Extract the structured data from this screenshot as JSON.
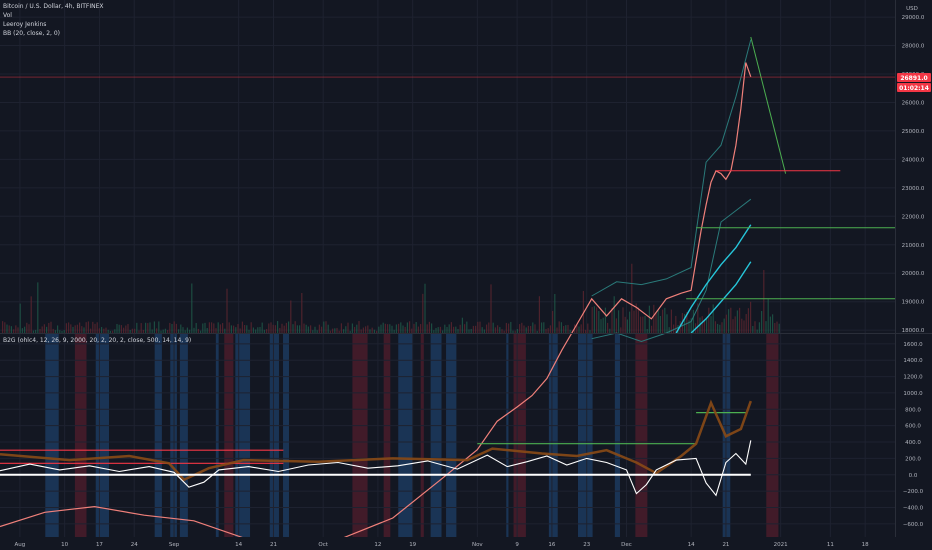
{
  "main_pane": {
    "title": "Bitcoin / U.S. Dollar, 4h, BITFINEX",
    "indicators": [
      "Vol",
      "Leeroy Jenkins",
      "BB (20, close, 2, 0)"
    ],
    "currency": "USD",
    "price_badge": "26891.0",
    "time_badge": "01:02:14",
    "colors": {
      "badge": "#f23645",
      "bg": "#131722",
      "grid": "#1e2230"
    }
  },
  "lower_pane": {
    "title": "B2G (ohlc4, 12, 26, 9, 2000, 20, 2, 20, 2, close, 500, 14, 14, 9)"
  },
  "chart_data": [
    {
      "type": "line",
      "title": "",
      "y_ticks": [
        18000,
        19000,
        20000,
        21000,
        22000,
        23000,
        24000,
        25000,
        26000,
        27000,
        28000,
        29000
      ],
      "ylim": [
        17900,
        29600
      ],
      "x_tick_labels": [
        "Aug",
        "10",
        "17",
        "24",
        "Sep",
        "14",
        "21",
        "Oct",
        "12",
        "19",
        "Nov",
        "9",
        "16",
        "23",
        "Dec",
        "14",
        "21",
        "2021",
        "11",
        "18"
      ],
      "x_tick_days": [
        0,
        9,
        16,
        23,
        31,
        44,
        51,
        61,
        72,
        79,
        92,
        100,
        107,
        114,
        122,
        135,
        142,
        153,
        163,
        170
      ],
      "x_range_days": [
        -4,
        176
      ],
      "last_price": 26891.0,
      "price": {
        "x": [
          -4,
          5,
          15,
          25,
          35,
          45,
          55,
          65,
          75,
          85,
          92,
          96,
          100,
          103,
          106,
          109,
          112,
          115,
          118,
          121,
          124,
          127,
          130,
          133,
          135,
          137,
          138,
          139,
          140,
          141,
          142,
          143,
          144,
          145,
          146,
          147
        ],
        "y": [
          11100,
          11600,
          11800,
          11500,
          11300,
          10700,
          10500,
          10700,
          11400,
          12800,
          13800,
          14800,
          15300,
          15700,
          16300,
          17300,
          18200,
          19100,
          18500,
          19100,
          18800,
          18400,
          19100,
          19300,
          19400,
          21500,
          22400,
          23200,
          23600,
          23500,
          23300,
          23600,
          24500,
          25800,
          27400,
          26900
        ]
      },
      "bb_upper": {
        "x": [
          115,
          120,
          125,
          130,
          135,
          138,
          141,
          144,
          147
        ],
        "y": [
          19200,
          19700,
          19600,
          19800,
          20200,
          23900,
          24500,
          26200,
          28200
        ]
      },
      "bb_lower": {
        "x": [
          115,
          120,
          125,
          130,
          135,
          138,
          141,
          144,
          147
        ],
        "y": [
          17700,
          17900,
          17600,
          17900,
          18300,
          19400,
          21800,
          22200,
          22600
        ]
      },
      "ma_fast": {
        "x": [
          132,
          135,
          138,
          141,
          144,
          147
        ],
        "y": [
          17900,
          18800,
          19600,
          20300,
          20900,
          21700
        ]
      },
      "ma_slow": {
        "x": [
          135,
          138,
          141,
          144,
          147
        ],
        "y": [
          17900,
          18400,
          19000,
          19600,
          20400
        ]
      },
      "annotations": [
        {
          "x": [
            147,
            154
          ],
          "y": [
            28300,
            23500
          ]
        },
        {
          "x": [
            140,
            165
          ],
          "y": [
            23600,
            23600
          ]
        },
        {
          "x": [
            136,
            176
          ],
          "y": [
            21600,
            21600
          ]
        },
        {
          "x": [
            134,
            176
          ],
          "y": [
            19100,
            19100
          ]
        }
      ]
    },
    {
      "type": "line",
      "title": "",
      "y_ticks": [
        -600,
        -400,
        -200,
        0,
        200,
        400,
        600,
        800,
        1000,
        1200,
        1400,
        1600
      ],
      "ylim": [
        -760,
        1720
      ],
      "zero_line": 0,
      "oscillator": {
        "x": [
          -4,
          2,
          8,
          14,
          20,
          26,
          31,
          34,
          37,
          40,
          46,
          52,
          58,
          64,
          70,
          76,
          82,
          88,
          94,
          98,
          102,
          106,
          110,
          114,
          118,
          122,
          124,
          126,
          128,
          132,
          136,
          138,
          140,
          142,
          144,
          146,
          147
        ],
        "y": [
          50,
          130,
          60,
          110,
          40,
          100,
          30,
          -150,
          -90,
          60,
          100,
          40,
          120,
          150,
          80,
          110,
          170,
          70,
          240,
          100,
          160,
          230,
          120,
          200,
          150,
          60,
          -230,
          -120,
          60,
          180,
          200,
          -100,
          -250,
          150,
          260,
          130,
          420
        ]
      },
      "signal": {
        "x": [
          -4,
          10,
          22,
          30,
          33,
          38,
          45,
          60,
          75,
          90,
          95,
          105,
          112,
          118,
          124,
          128,
          133,
          136,
          139,
          142,
          145,
          147
        ],
        "y": [
          250,
          180,
          230,
          140,
          -60,
          80,
          180,
          160,
          200,
          180,
          320,
          260,
          230,
          300,
          150,
          20,
          230,
          380,
          880,
          470,
          560,
          900
        ]
      },
      "threshold_lines": [
        {
          "x": [
            -4,
            53
          ],
          "y": [
            140,
            140
          ],
          "color": "#f23645"
        },
        {
          "x": [
            -4,
            53
          ],
          "y": [
            300,
            300
          ],
          "color": "#f23645"
        },
        {
          "x": [
            92,
            136
          ],
          "y": [
            380,
            380
          ],
          "color": "#4caf50"
        },
        {
          "x": [
            136,
            146
          ],
          "y": [
            760,
            760
          ],
          "color": "#4caf50"
        }
      ]
    }
  ]
}
